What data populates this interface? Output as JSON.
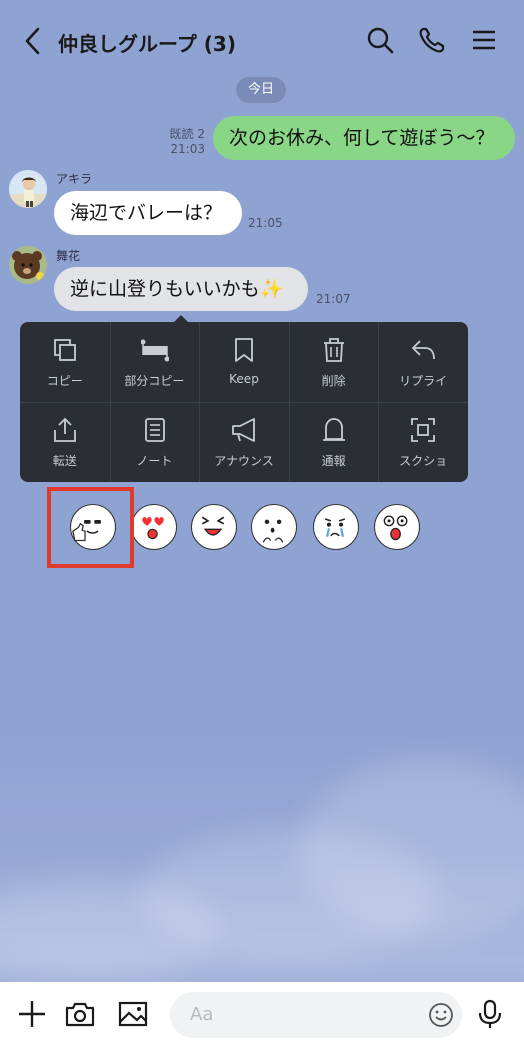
{
  "header": {
    "title": "仲良しグループ (3)"
  },
  "date_label": "今日",
  "messages": [
    {
      "side": "me",
      "text": "次のお休み、何して遊ぼう〜？",
      "read": "既読 2",
      "time": "21:03"
    },
    {
      "side": "other",
      "sender": "アキラ",
      "text": "海辺でバレーは？",
      "time": "21:05"
    },
    {
      "side": "other",
      "sender": "舞花",
      "text": "逆に山登りもいいかも✨",
      "time": "21:07"
    }
  ],
  "context_menu": [
    {
      "label": "コピー",
      "icon": "copy-icon"
    },
    {
      "label": "部分コピー",
      "icon": "partial-copy-icon"
    },
    {
      "label": "Keep",
      "icon": "bookmark-icon"
    },
    {
      "label": "削除",
      "icon": "trash-icon"
    },
    {
      "label": "リプライ",
      "icon": "reply-icon"
    },
    {
      "label": "転送",
      "icon": "share-icon"
    },
    {
      "label": "ノート",
      "icon": "note-icon"
    },
    {
      "label": "アナウンス",
      "icon": "megaphone-icon"
    },
    {
      "label": "通報",
      "icon": "report-icon"
    },
    {
      "label": "スクショ",
      "icon": "screenshot-icon"
    }
  ],
  "reactions": [
    "thumbs-up",
    "heart-eyes",
    "laughing",
    "surprised",
    "crying",
    "shocked"
  ],
  "input": {
    "placeholder": "Aa"
  },
  "colors": {
    "background": "#8fa3d3",
    "my_bubble": "#89d686",
    "menu": "#2b2e35",
    "highlight": "#e03a2c"
  }
}
